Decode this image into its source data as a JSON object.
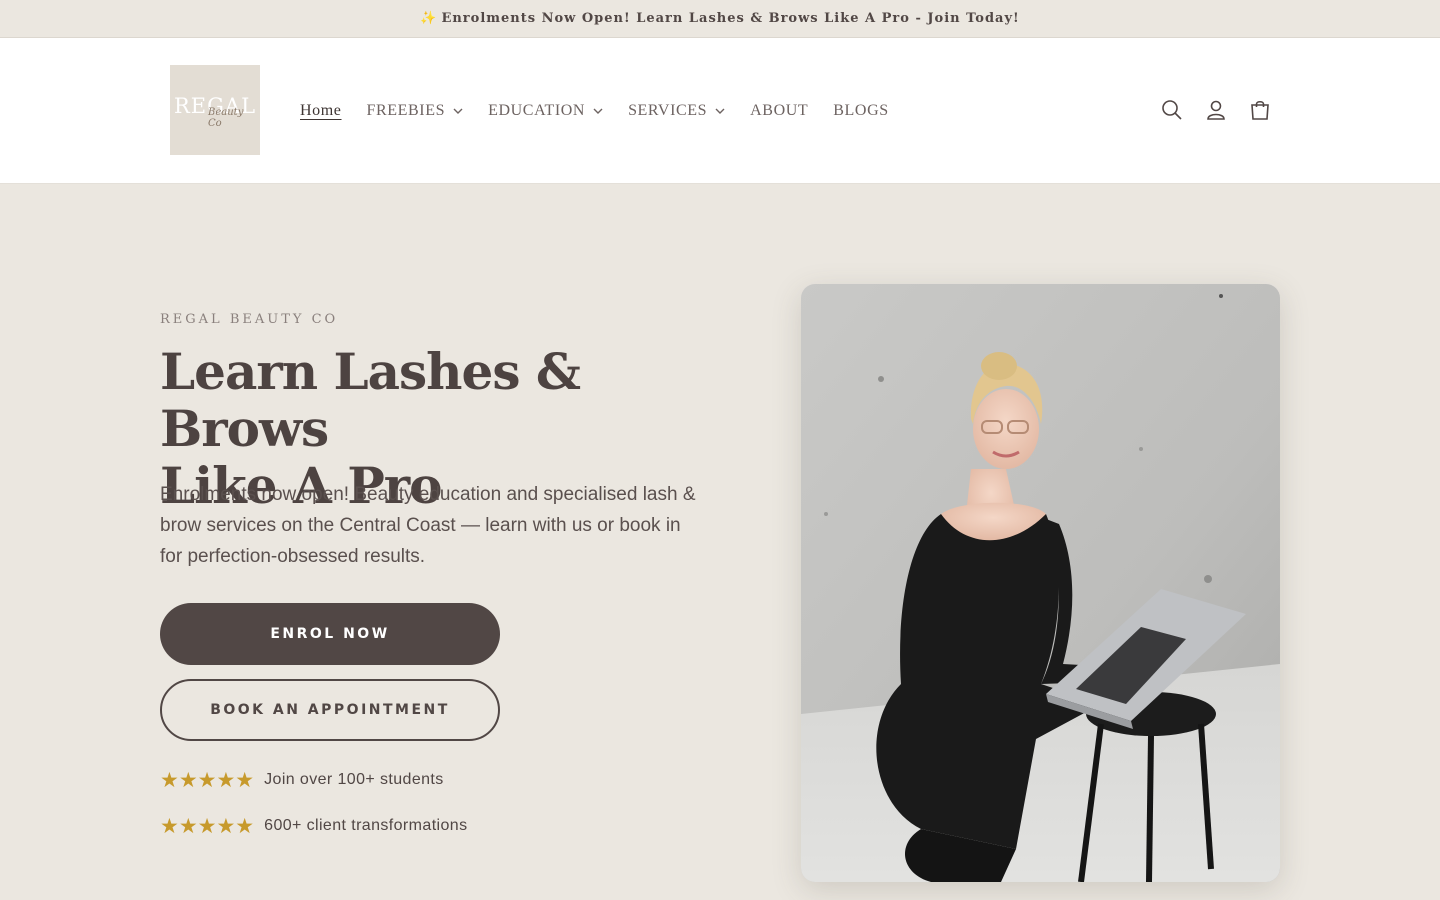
{
  "announcement": {
    "icon": "sparkles-icon",
    "text": "Enrolments Now Open! Learn Lashes & Brows Like A Pro - Join Today!"
  },
  "header": {
    "logo": {
      "word": "REGAL",
      "script": "Beauty Co"
    },
    "nav": [
      {
        "label": "Home",
        "active": true,
        "has_dropdown": false
      },
      {
        "label": "FREEBIES",
        "has_dropdown": true
      },
      {
        "label": "EDUCATION",
        "has_dropdown": true
      },
      {
        "label": "SERVICES",
        "has_dropdown": true
      },
      {
        "label": "ABOUT",
        "has_dropdown": false
      },
      {
        "label": "BLOGS",
        "has_dropdown": false
      }
    ],
    "icons": [
      "search-icon",
      "account-icon",
      "cart-icon"
    ]
  },
  "hero": {
    "eyebrow": "REGAL BEAUTY CO",
    "title_line1": "Learn Lashes & Brows",
    "title_line2": "Like A Pro",
    "description": "Enrolments now open! Beauty education and specialised lash & brow services on the Central Coast — learn with us or book in for perfection-obsessed results.",
    "primary_button": "ENROL NOW",
    "secondary_button": "BOOK AN APPOINTMENT",
    "ratings": [
      {
        "stars": "★★★★★",
        "text": "Join over 100+ students"
      },
      {
        "stars": "★★★★★",
        "text": "600+ client transformations"
      }
    ]
  },
  "colors": {
    "background": "#ebe7e0",
    "primary": "#514745",
    "star": "#c79a2c",
    "header_bg": "#ffffff"
  }
}
